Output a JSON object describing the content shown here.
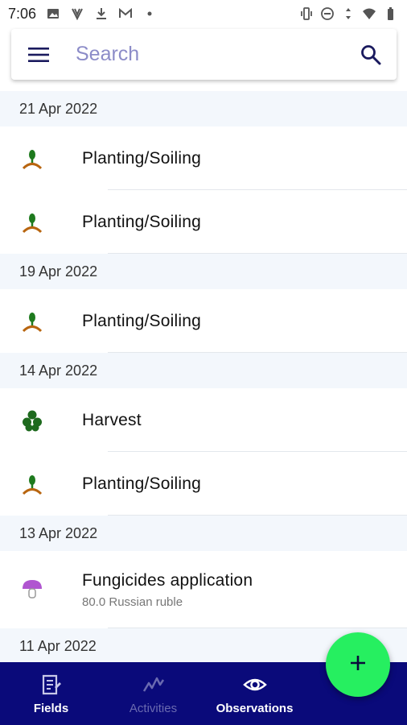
{
  "status_bar": {
    "time": "7:06"
  },
  "search": {
    "placeholder": "Search"
  },
  "groups": [
    {
      "date": "21 Apr 2022",
      "items": [
        {
          "title": "Planting/Soiling",
          "icon": "planting-icon"
        },
        {
          "title": "Planting/Soiling",
          "icon": "planting-icon"
        }
      ]
    },
    {
      "date": "19 Apr 2022",
      "items": [
        {
          "title": "Planting/Soiling",
          "icon": "planting-icon"
        }
      ]
    },
    {
      "date": "14 Apr 2022",
      "items": [
        {
          "title": "Harvest",
          "icon": "harvest-icon"
        },
        {
          "title": "Planting/Soiling",
          "icon": "planting-icon"
        }
      ]
    },
    {
      "date": "13 Apr 2022",
      "items": [
        {
          "title": "Fungicides application",
          "subtitle": "80.0 Russian ruble",
          "icon": "mushroom-icon"
        }
      ]
    },
    {
      "date": "11 Apr 2022",
      "items": []
    }
  ],
  "nav": {
    "fields": "Fields",
    "activities": "Activities",
    "observations": "Observations"
  },
  "colors": {
    "nav_bg": "#0a0a7a",
    "fab": "#26ef60",
    "date_header_bg": "#f3f7fc",
    "accent_text": "#8c8cc8"
  }
}
